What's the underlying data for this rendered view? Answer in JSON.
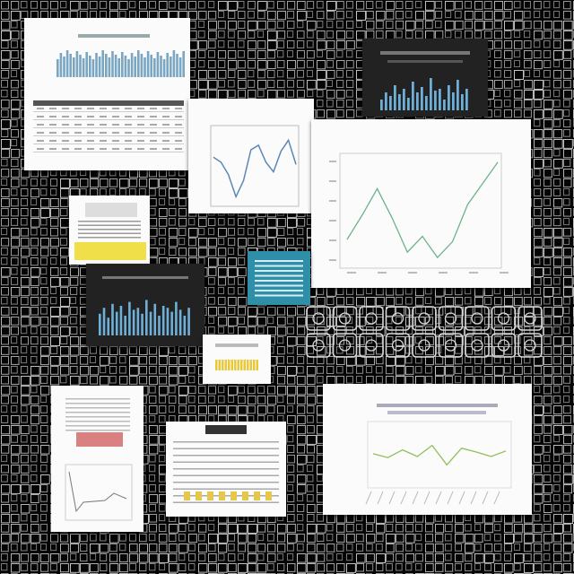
{
  "board": {
    "background": "#050505",
    "grid_color": "#cfcfcf"
  },
  "cards": {
    "top_left_table": {
      "accent": "#7aa6c2"
    },
    "small_line": {
      "title": "",
      "line_color": "#5b87b5",
      "values": [
        0.62,
        0.55,
        0.38,
        0.08,
        0.3,
        0.72,
        0.78,
        0.55,
        0.42,
        0.7,
        0.85,
        0.52
      ]
    },
    "dark_bars_top": {
      "bar_color": "#6fb0d9",
      "values": [
        0.3,
        0.5,
        0.4,
        0.7,
        0.45,
        0.6,
        0.35,
        0.8,
        0.5,
        0.65,
        0.4,
        0.9,
        0.55,
        0.6,
        0.3,
        0.7,
        0.5,
        0.85,
        0.45,
        0.6
      ]
    },
    "large_line": {
      "title": "",
      "xlabel": "",
      "line_color": "#6db38a",
      "values": [
        0.22,
        0.45,
        0.7,
        0.42,
        0.1,
        0.25,
        0.05,
        0.2,
        0.55,
        0.75,
        0.95
      ]
    },
    "yellow_panel": {
      "accent": "#f1df4a"
    },
    "dark_bars_mid": {
      "bar_color": "#6fb0d9",
      "values": [
        0.55,
        0.7,
        0.45,
        0.8,
        0.6,
        0.75,
        0.5,
        0.85,
        0.65,
        0.7,
        0.55,
        0.9,
        0.6,
        0.8,
        0.5,
        0.75,
        0.7,
        0.6,
        0.85,
        0.65,
        0.5,
        0.7
      ]
    },
    "teal_panel": {
      "accent": "#2f8fa8"
    },
    "small_yellow": {
      "accent": "#e8c93a"
    },
    "chip_grid": {
      "rows": 2,
      "cols": 9
    },
    "bottom_left_chart": {
      "accent": "#d98080"
    },
    "bottom_mid_table": {
      "accent": "#e6c74a"
    },
    "bottom_right_line": {
      "title": "",
      "line_color": "#8fbf5a",
      "values": [
        0.55,
        0.48,
        0.62,
        0.5,
        0.7,
        0.35,
        0.65,
        0.58,
        0.5,
        0.6
      ]
    }
  }
}
